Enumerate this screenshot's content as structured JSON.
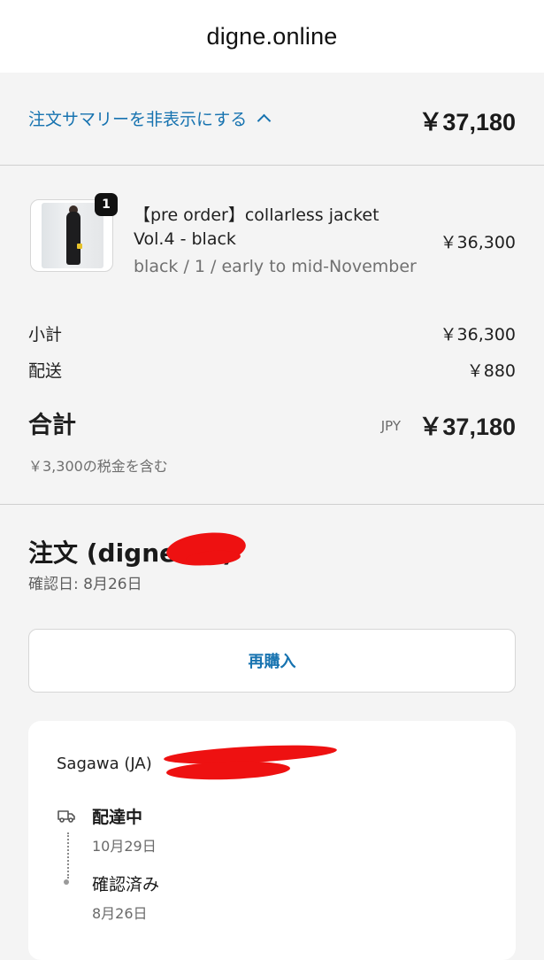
{
  "header": {
    "site": "digne.online"
  },
  "summary_toggle": {
    "label": "注文サマリーを非表示にする",
    "total": "￥37,180",
    "icon": "chevron-up-icon"
  },
  "item": {
    "quantity": "1",
    "title": "【pre order】collarless jacket",
    "subtitle": "Vol.4 - black",
    "variant": "black / 1 / early to mid-November",
    "price": "￥36,300"
  },
  "totals": {
    "subtotal_label": "小計",
    "subtotal": "￥36,300",
    "shipping_label": "配送",
    "shipping": "￥880",
    "total_label": "合計",
    "currency": "JPY",
    "total": "￥37,180",
    "tax_note": "￥3,300の税金を含む"
  },
  "order": {
    "title_prefix": "注文 (digne",
    "title_suffix": ")",
    "confirmed": "確認日: 8月26日",
    "rebuy_label": "再購入"
  },
  "shipment": {
    "carrier": "Sagawa (JA)",
    "statuses": [
      {
        "label": "配達中",
        "date": "10月29日",
        "icon": "truck-icon"
      },
      {
        "label": "確認済み",
        "date": "8月26日",
        "icon": "dot-icon"
      }
    ]
  },
  "colors": {
    "accent": "#1773b0",
    "redaction": "#ee1111"
  }
}
